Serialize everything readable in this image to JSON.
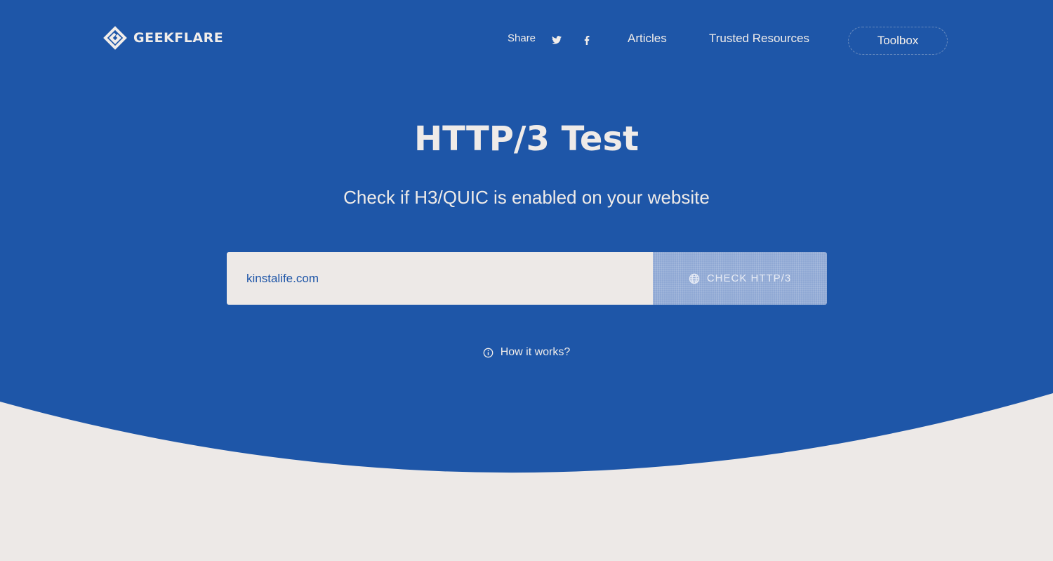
{
  "brand": {
    "name": "GEEKFLARE",
    "logo_icon": "geekflare-logo-icon"
  },
  "nav": {
    "share_label": "Share",
    "twitter_icon": "twitter-icon",
    "facebook_icon": "facebook-icon",
    "links": [
      {
        "label": "Articles"
      },
      {
        "label": "Trusted Resources"
      }
    ],
    "toolbox_label": "Toolbox"
  },
  "hero": {
    "title": "HTTP/3 Test",
    "subtitle": "Check if H3/QUIC is enabled on your website"
  },
  "form": {
    "url_value": "kinstalife.com",
    "button_label": "CHECK HTTP/3",
    "button_icon": "globe-icon"
  },
  "help": {
    "label": "How it works?",
    "icon": "info-icon"
  },
  "colors": {
    "hero_blue": "#1e56a8",
    "page_bg": "#ede9e7",
    "text_light": "#f1edea",
    "button_bg": "#8fa8d4"
  }
}
